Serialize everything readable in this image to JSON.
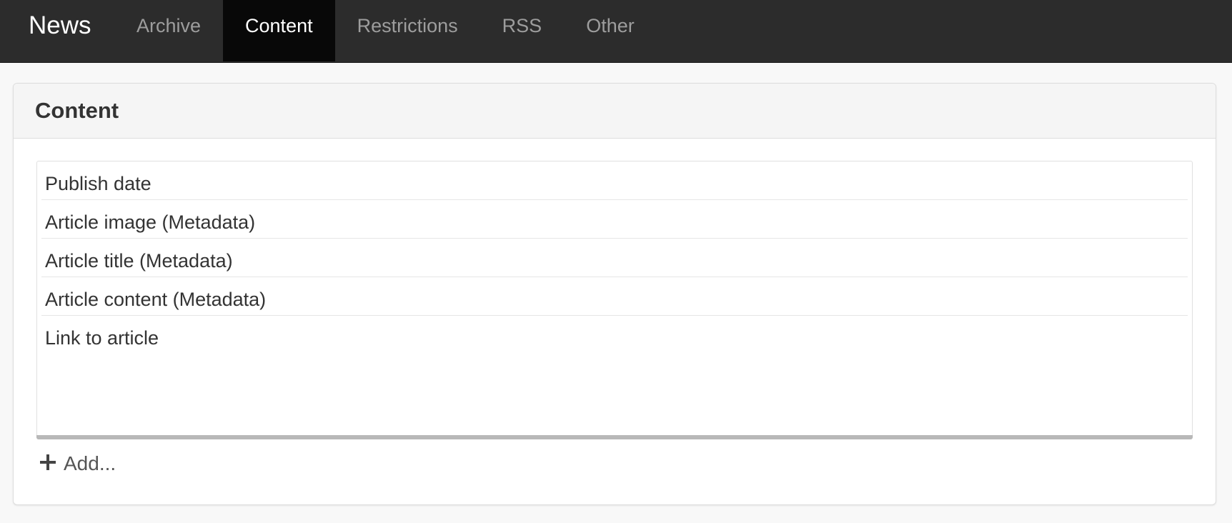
{
  "navbar": {
    "brand": "News",
    "tabs": [
      {
        "label": "Archive",
        "active": false
      },
      {
        "label": "Content",
        "active": true
      },
      {
        "label": "Restrictions",
        "active": false
      },
      {
        "label": "RSS",
        "active": false
      },
      {
        "label": "Other",
        "active": false
      }
    ]
  },
  "panel": {
    "title": "Content",
    "items": [
      {
        "label": "Publish date"
      },
      {
        "label": "Article image (Metadata)"
      },
      {
        "label": "Article title (Metadata)"
      },
      {
        "label": "Article content (Metadata)"
      },
      {
        "label": "Link to article"
      }
    ],
    "add_label": "Add...",
    "add_icon": "plus-icon"
  },
  "colors": {
    "navbar_bg": "#2c2c2c",
    "active_tab_bg": "#080808",
    "active_tab_text": "#ffffff",
    "inactive_tab_text": "#9d9d9d",
    "page_bg": "#f8f8f8",
    "panel_heading_bg": "#f5f5f5"
  }
}
